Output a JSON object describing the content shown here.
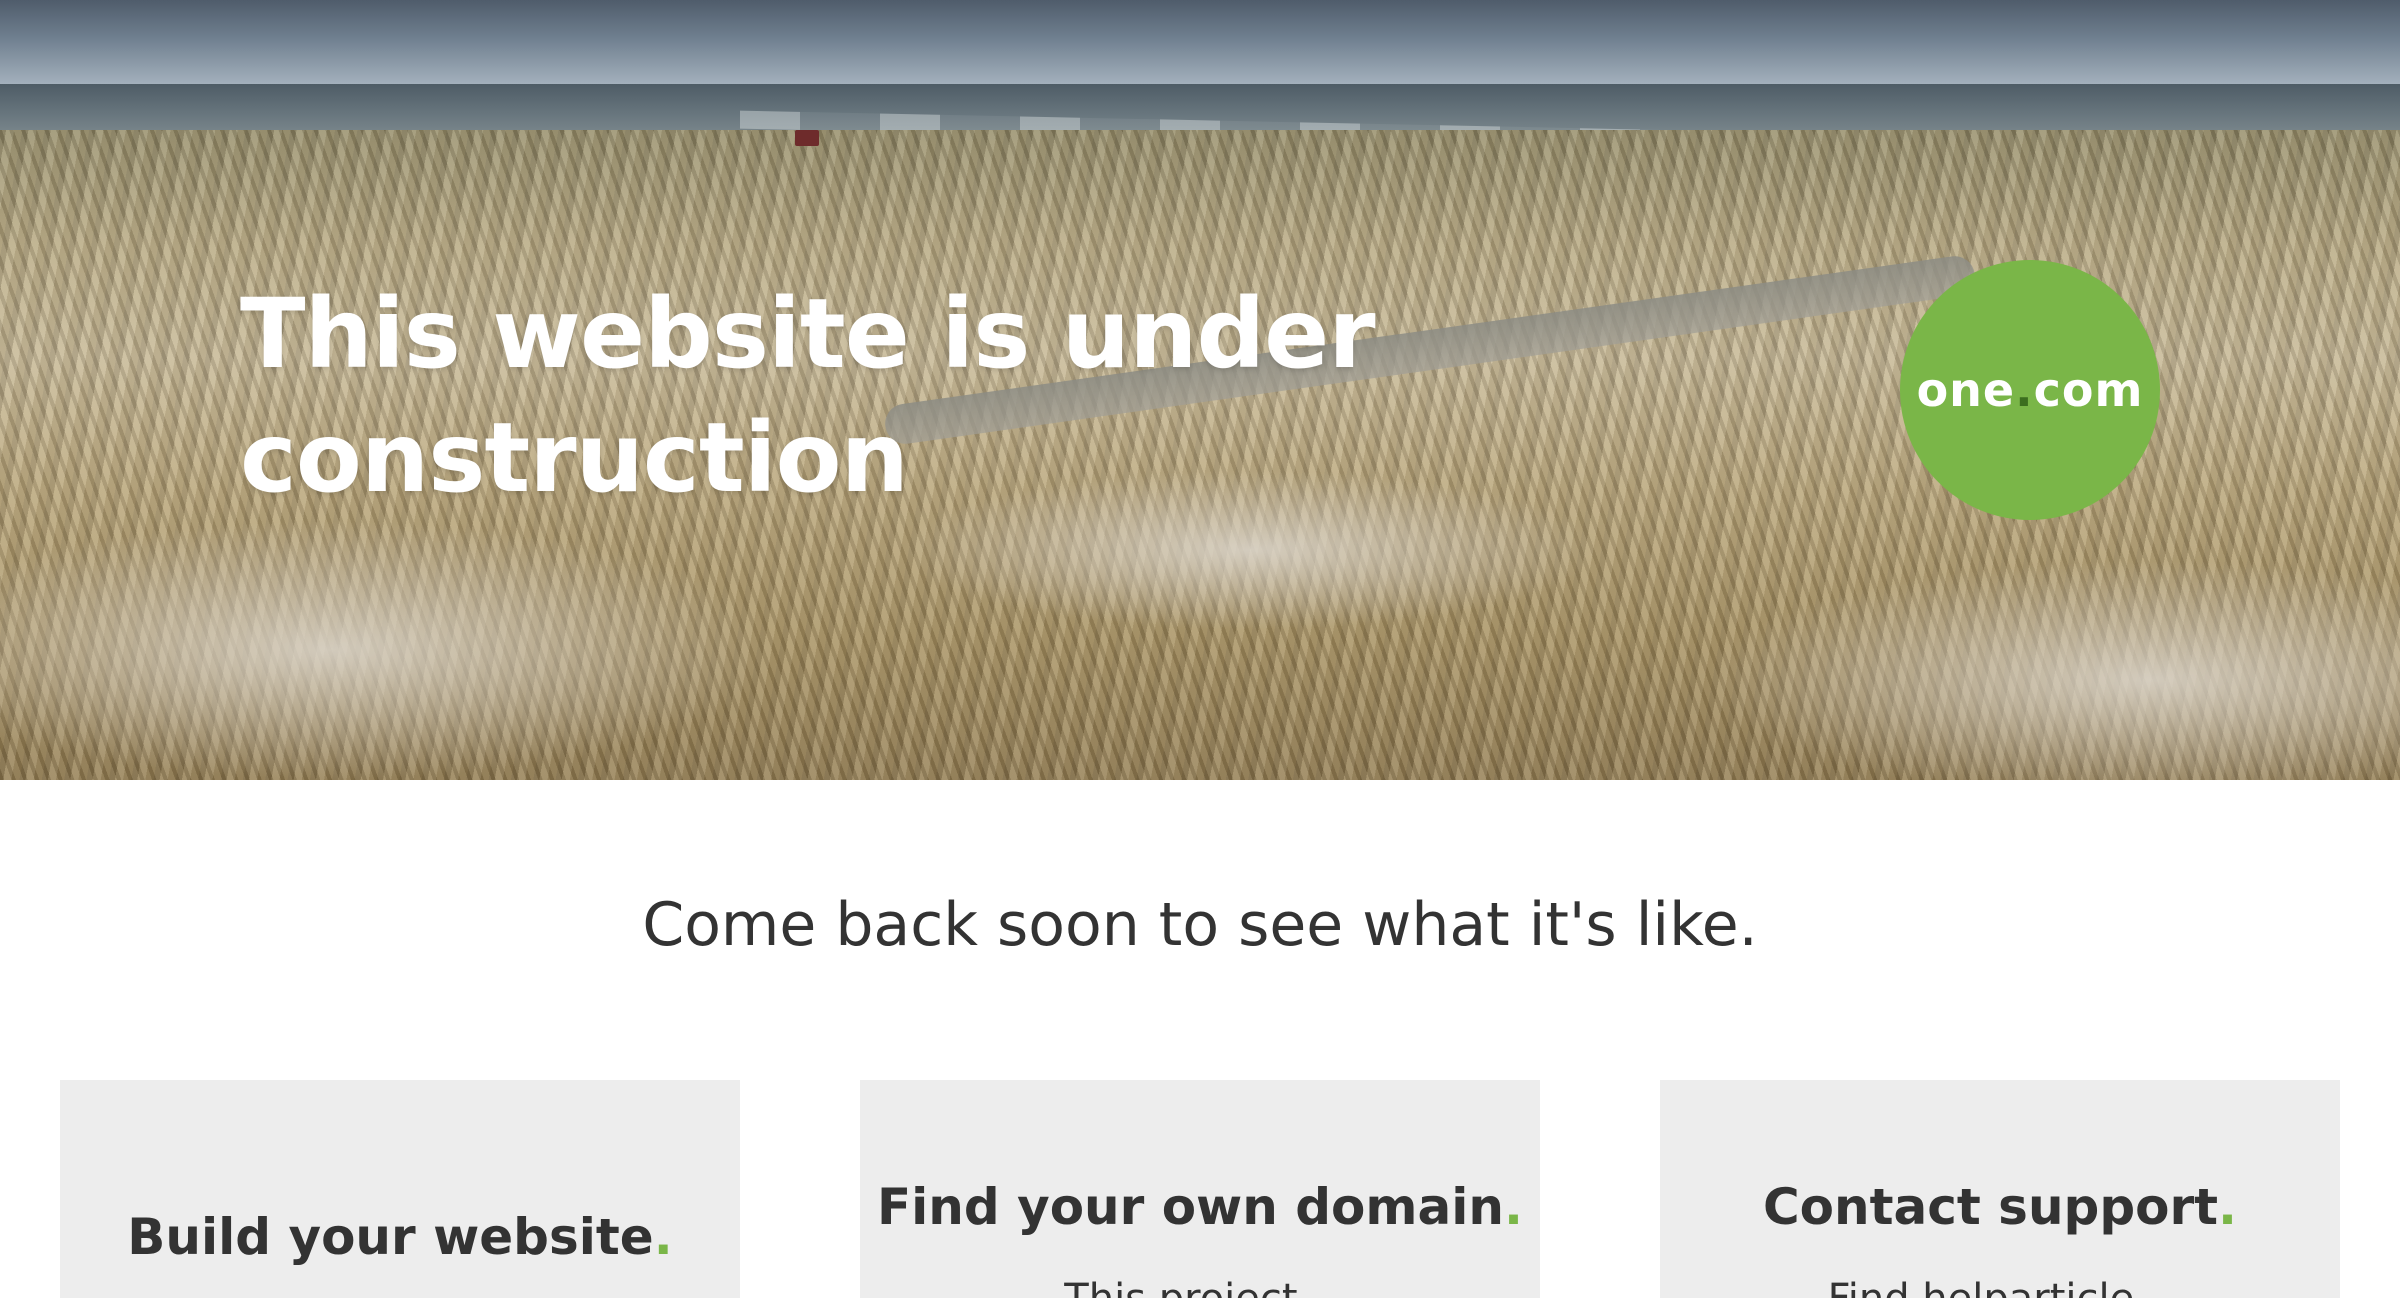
{
  "hero": {
    "title": "This website is under construction",
    "brand": {
      "name_part": "one",
      "dot": ".",
      "tld_part": "com"
    }
  },
  "tagline": "Come back soon to see what it's like.",
  "cards": [
    {
      "title": "Build your website",
      "accent": ".",
      "text": ""
    },
    {
      "title": "Find your own domain",
      "accent": ".",
      "text": "This project... "
    },
    {
      "title": "Contact support",
      "accent": ".",
      "text": "Find helparticle..."
    }
  ],
  "colors": {
    "brand_green": "#7ab648",
    "text_dark": "#333333",
    "card_bg": "#ededed"
  }
}
